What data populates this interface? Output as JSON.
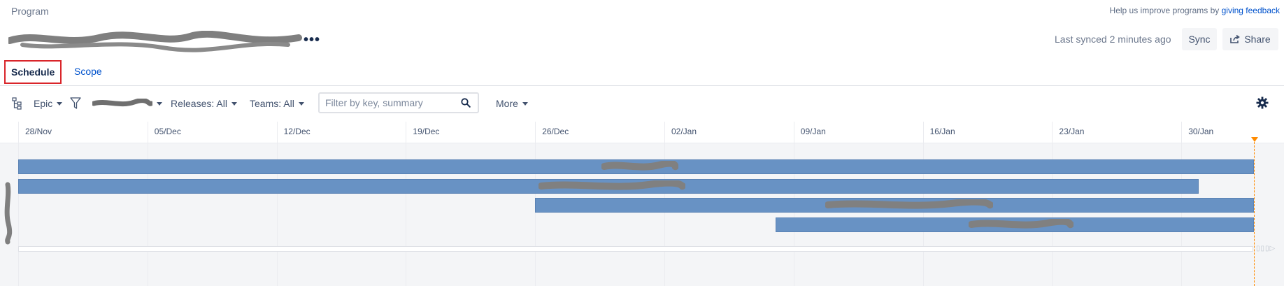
{
  "header": {
    "breadcrumb": "Program",
    "feedback_prefix": "Help us improve programs by",
    "feedback_link": "giving feedback",
    "more_glyph": "•••",
    "last_synced": "Last synced 2 minutes ago",
    "sync_label": "Sync",
    "share_label": "Share"
  },
  "tabs": [
    {
      "label": "Schedule",
      "active": true
    },
    {
      "label": "Scope",
      "active": false
    }
  ],
  "toolbar": {
    "hierarchy_label": "Epic",
    "releases_label": "Releases: All",
    "teams_label": "Teams: All",
    "filter_placeholder": "Filter by key, summary",
    "more_label": "More"
  },
  "timeline": {
    "dates": [
      "28/Nov",
      "05/Dec",
      "12/Dec",
      "19/Dec",
      "26/Dec",
      "02/Jan",
      "09/Jan",
      "16/Jan",
      "23/Jan",
      "30/Jan"
    ],
    "bars": [
      {
        "start": "28/Nov",
        "end": "today"
      },
      {
        "start": "28/Nov",
        "end": "~31/Jan"
      },
      {
        "start": "26/Dec",
        "end": "today"
      },
      {
        "start": "08/Jan",
        "end": "today"
      }
    ]
  },
  "colors": {
    "bar": "#6892c4",
    "accent_link": "#0052cc",
    "today_marker": "#ff8b00",
    "active_tab_outline": "#d9252a"
  },
  "icons": [
    "hierarchy-icon",
    "filter-icon",
    "search-icon",
    "share-icon",
    "gear-icon"
  ]
}
